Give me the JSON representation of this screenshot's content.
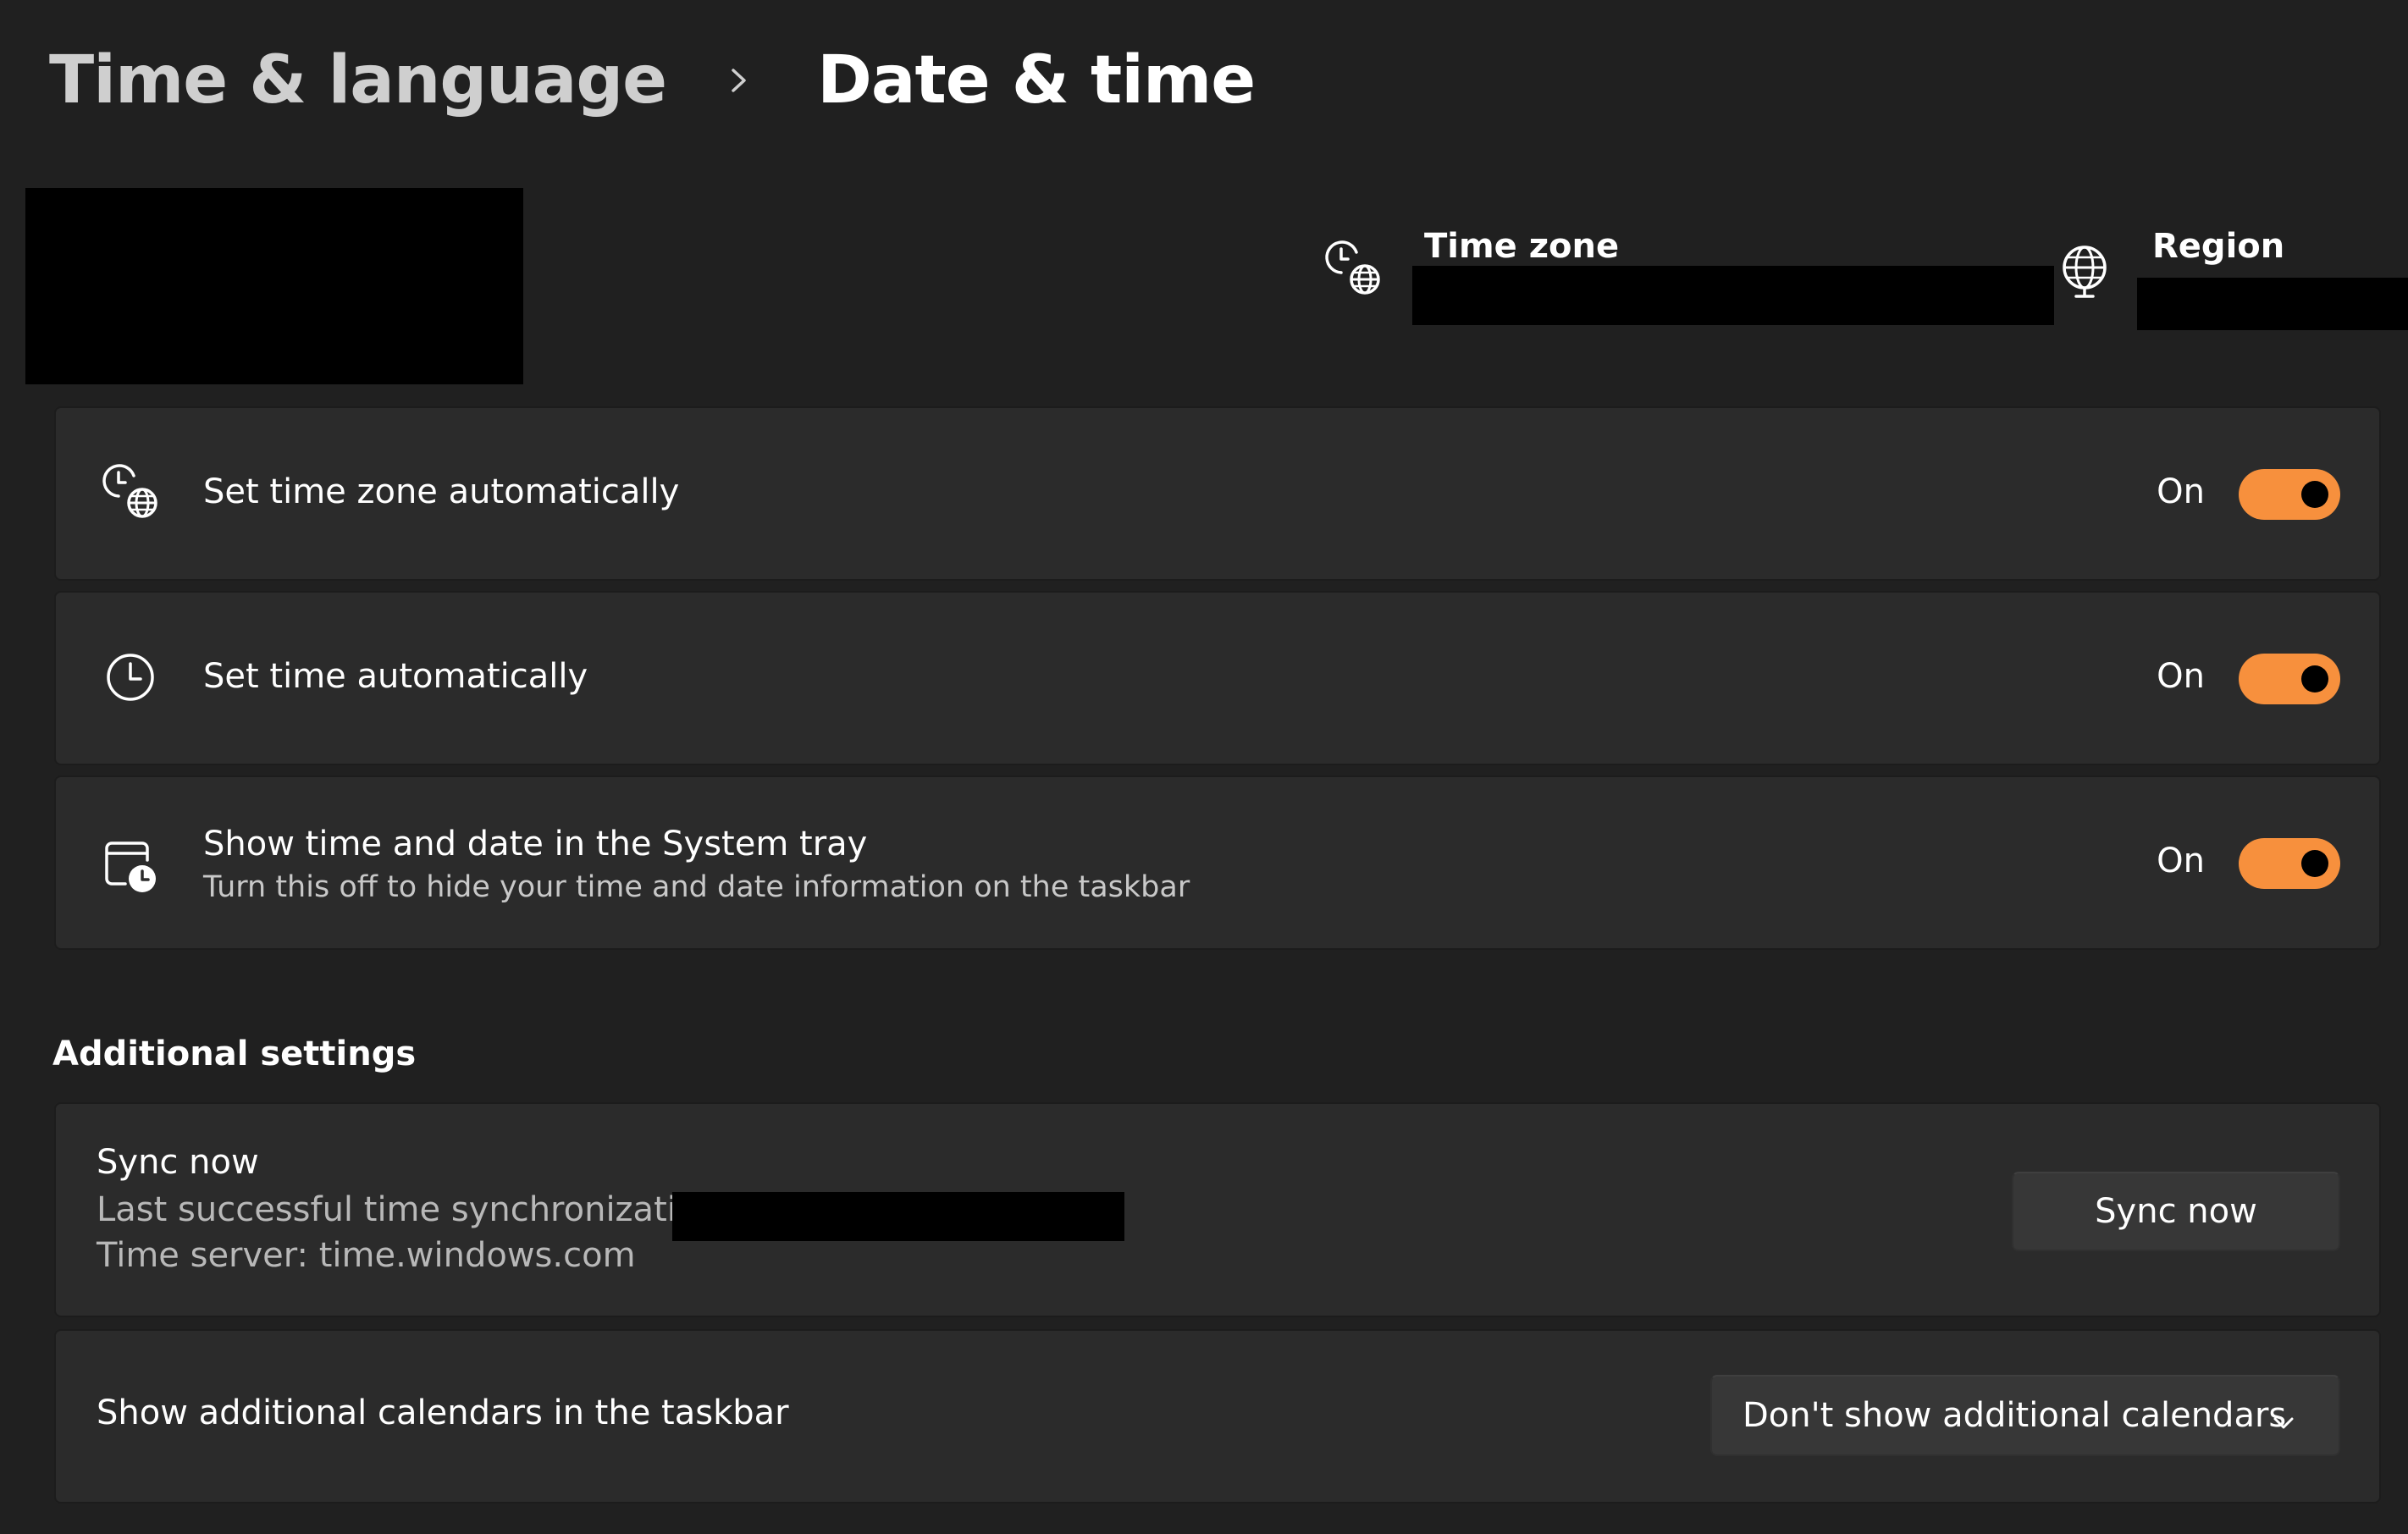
{
  "breadcrumb": {
    "parent": "Time & language",
    "current": "Date & time"
  },
  "header": {
    "time_zone_label": "Time zone",
    "region_label": "Region"
  },
  "settings": [
    {
      "title": "Set time zone automatically",
      "state": "On",
      "icon": "clock-globe-icon"
    },
    {
      "title": "Set time automatically",
      "state": "On",
      "icon": "clock-icon"
    },
    {
      "title": "Show time and date in the System tray",
      "subtitle": "Turn this off to hide your time and date information on the taskbar",
      "state": "On",
      "icon": "calendar-clock-icon"
    }
  ],
  "additional": {
    "heading": "Additional settings",
    "sync": {
      "title": "Sync now",
      "last_sync_label": "Last successful time synchronization:",
      "server": "Time server: time.windows.com",
      "button": "Sync now"
    },
    "calendars": {
      "title": "Show additional calendars in the taskbar",
      "selected": "Don't show additional calendars"
    }
  },
  "colors": {
    "background": "#202020",
    "card": "#2b2b2b",
    "accent": "#f7903d",
    "redaction": "#000000"
  }
}
